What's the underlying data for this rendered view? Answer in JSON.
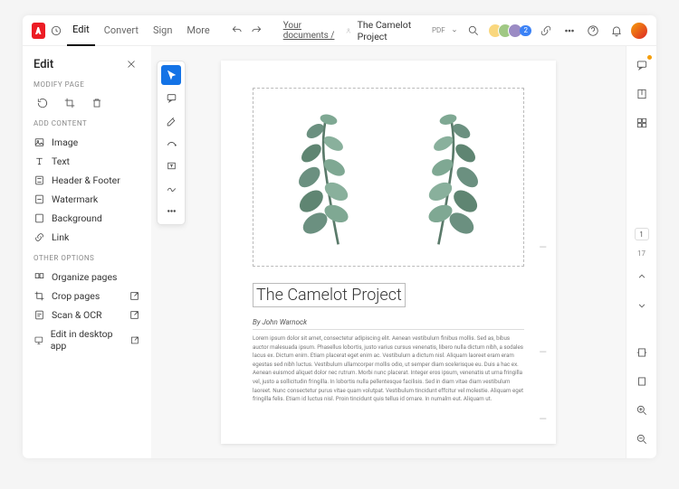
{
  "topbar": {
    "tabs": [
      "Edit",
      "Convert",
      "Sign",
      "More"
    ],
    "activeTab": 0,
    "breadcrumb_root": "Your documents /",
    "doc_title": "The Camelot Project",
    "doc_ext": "PDF",
    "presence_count": "2"
  },
  "sidebar": {
    "title": "Edit",
    "sections": {
      "modify": "Modify page",
      "add": "Add content",
      "other": "Other options"
    },
    "addItems": [
      "Image",
      "Text",
      "Header & Footer",
      "Watermark",
      "Background",
      "Link"
    ],
    "otherItems": [
      "Organize pages",
      "Crop pages",
      "Scan & OCR",
      "Edit in desktop app"
    ]
  },
  "document": {
    "h1": "The Camelot Project",
    "byline": "By John Warnock",
    "body": "Lorem ipsum dolor sit amet, consectetur adipiscing elit. Aenean vestibulum finibus mollis. Sed as, bibus auctor malesuada ipsum. Phasellus lobortis, justo varius cursus venenatis, libero nulla dictum nibh, a sodales lacus ex. Dictum enim. Etiam placerat eget enim ac. Vestibulum a dictum nisl. Aliquam laoreet eram eram egestas sed nibh luctus. Vestibulum ullamcorper mollis odio, ut semper diam scelerisque eu. Duis a hac ex. Aenean euismod aliquet dolor nec rutrum. Morbi nunc placerat. Integer eros ipsum, venenatis ut urna fringilla vel, justo a sollicitudin fringilla. In lobortis nulla pellentesque facilisis. Sed in diam vitae diam vestibulum laoreet. Nunc consectetur purus vitae quam volutpat. Vestibulum tincidunt effcitur vel molestie. Aliquam eget fringilla felis. Etiam id luctus nisl. Proin tincidunt quis tellus id ornare. In numalm eut. Aliquam ut."
  },
  "pager": {
    "current": "1",
    "total": "17"
  }
}
